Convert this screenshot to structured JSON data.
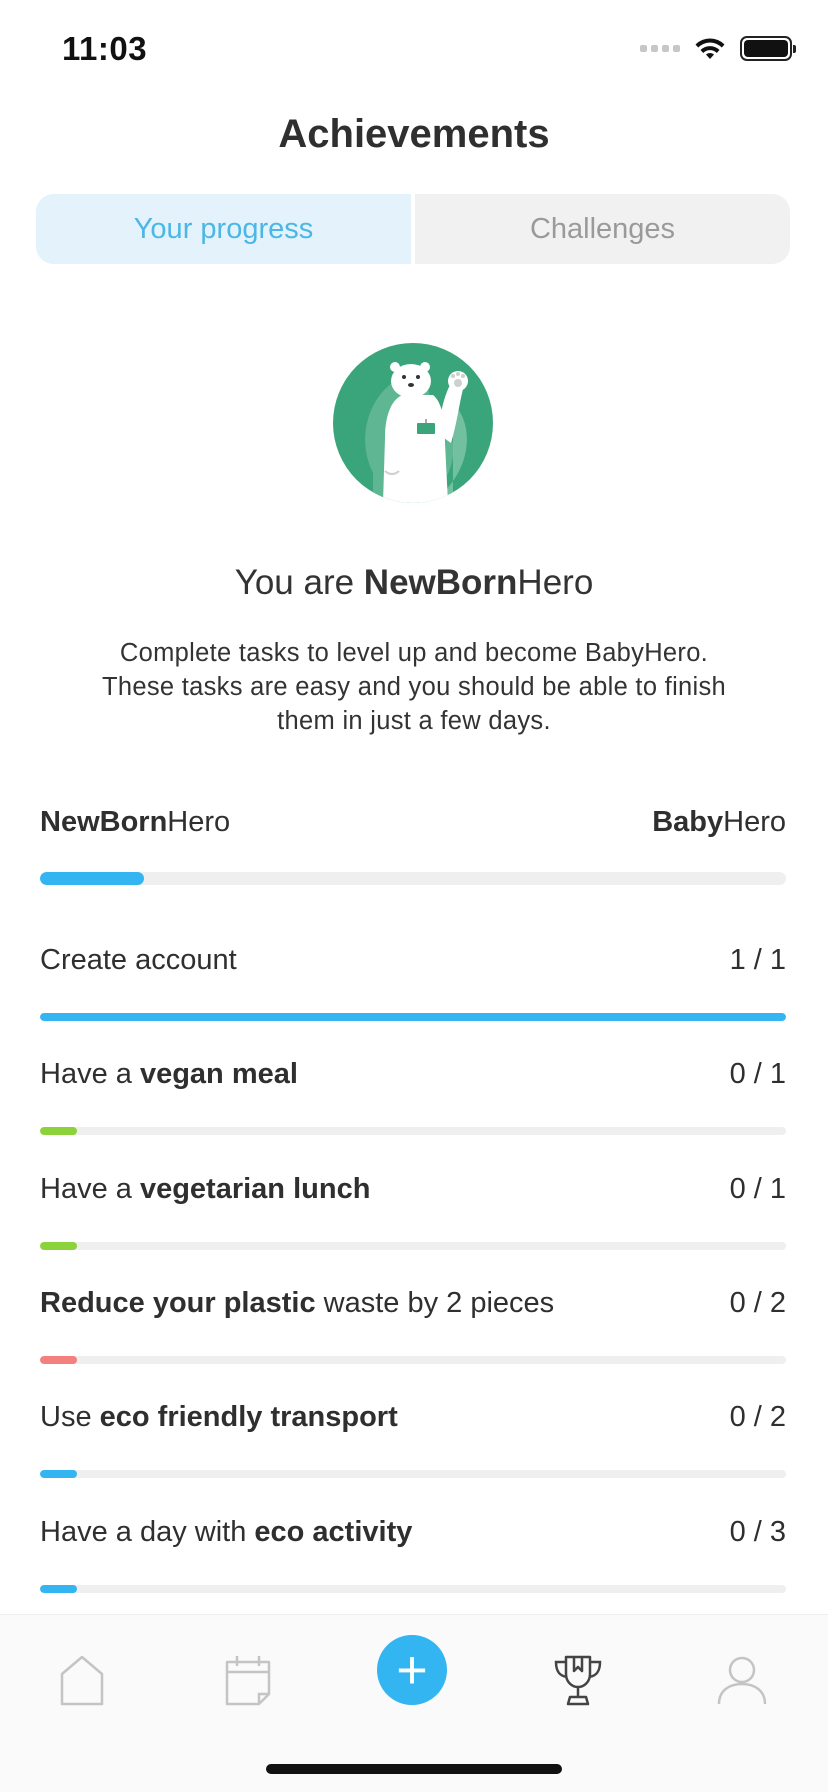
{
  "status_bar": {
    "time": "11:03"
  },
  "header": {
    "title": "Achievements"
  },
  "tabs": [
    {
      "label": "Your progress",
      "active": true
    },
    {
      "label": "Challenges",
      "active": false
    }
  ],
  "hero": {
    "prefix": "You are ",
    "level_bold": "NewBorn",
    "level_suffix": "Hero",
    "description_lines": [
      "Complete tasks to level up and become BabyHero.",
      "These tasks are easy and you should be able to finish",
      "them in just a few days."
    ]
  },
  "level_progress": {
    "current_bold": "NewBorn",
    "current_suffix": "Hero",
    "next_bold": "Baby",
    "next_suffix": "Hero",
    "progress": 0.14,
    "color": "#32b5f0"
  },
  "tasks": [
    {
      "parts": [
        {
          "text": "Create account",
          "bold": false
        }
      ],
      "count": "1 / 1",
      "progress": 1.0,
      "color": "#32b5f0"
    },
    {
      "parts": [
        {
          "text": "Have a ",
          "bold": false
        },
        {
          "text": "vegan meal",
          "bold": true
        }
      ],
      "count": "0 / 1",
      "progress": 0.05,
      "color": "#8cd23a"
    },
    {
      "parts": [
        {
          "text": "Have a ",
          "bold": false
        },
        {
          "text": "vegetarian lunch",
          "bold": true
        }
      ],
      "count": "0 / 1",
      "progress": 0.05,
      "color": "#8cd23a"
    },
    {
      "parts": [
        {
          "text": "Reduce your plastic",
          "bold": true
        },
        {
          "text": " waste by 2 pieces",
          "bold": false
        }
      ],
      "count": "0 / 2",
      "progress": 0.05,
      "color": "#f47f7f"
    },
    {
      "parts": [
        {
          "text": "Use ",
          "bold": false
        },
        {
          "text": "eco friendly transport",
          "bold": true
        }
      ],
      "count": "0 / 2",
      "progress": 0.05,
      "color": "#32b5f0"
    },
    {
      "parts": [
        {
          "text": "Have a day with ",
          "bold": false
        },
        {
          "text": "eco activity",
          "bold": true
        }
      ],
      "count": "0 / 3",
      "progress": 0.05,
      "color": "#32b5f0"
    }
  ],
  "tab_bar": {
    "items": [
      "home-icon",
      "calendar-icon",
      "add-icon",
      "trophy-icon",
      "profile-icon"
    ],
    "add_symbol": "+",
    "active_color": "#32b5f0"
  }
}
